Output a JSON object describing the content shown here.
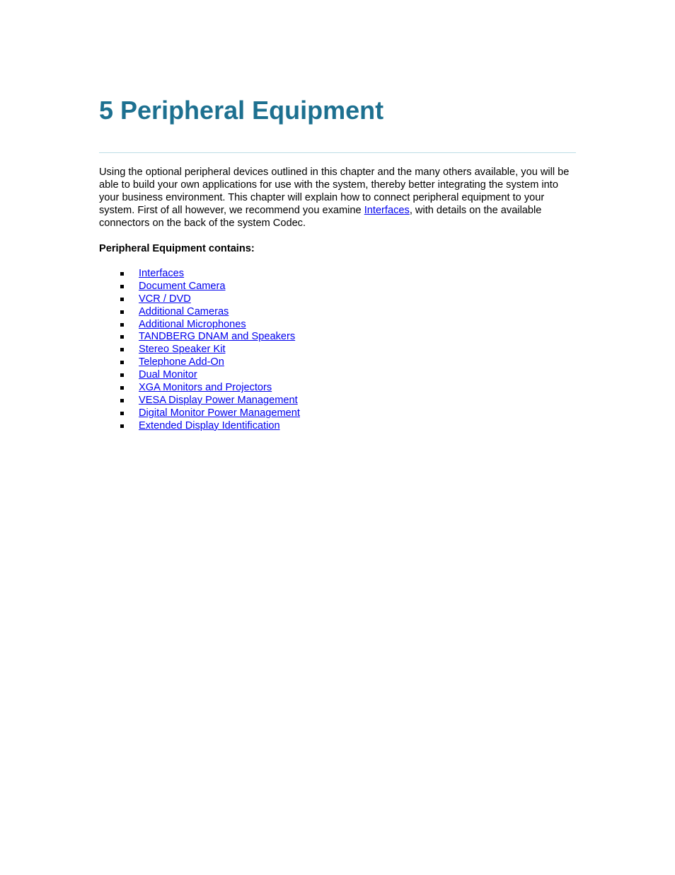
{
  "chapter": {
    "title": "5 Peripheral Equipment"
  },
  "intro": {
    "text_before_link": "Using the optional peripheral devices outlined in this chapter and the many others available, you will be able to build your own applications for use with the system, thereby better integrating the system into your business environment. This chapter will explain how to connect peripheral equipment to your system. First of all however, we recommend you examine ",
    "link_label": "Interfaces",
    "text_after_link": ", with details on the available connectors on the back of the system Codec."
  },
  "contents": {
    "heading": "Peripheral Equipment contains:",
    "items": [
      {
        "label": "Interfaces"
      },
      {
        "label": "Document Camera"
      },
      {
        "label": "VCR / DVD"
      },
      {
        "label": "Additional Cameras"
      },
      {
        "label": "Additional Microphones"
      },
      {
        "label": "TANDBERG DNAM and Speakers"
      },
      {
        "label": "Stereo Speaker Kit"
      },
      {
        "label": "Telephone Add-On"
      },
      {
        "label": "Dual Monitor"
      },
      {
        "label": "XGA Monitors and Projectors"
      },
      {
        "label": "VESA Display Power Management"
      },
      {
        "label": "Digital Monitor Power Management"
      },
      {
        "label": "Extended Display Identification"
      }
    ]
  },
  "colors": {
    "title": "#1d7090",
    "rule": "#bcdde6",
    "link": "#0000ee"
  }
}
